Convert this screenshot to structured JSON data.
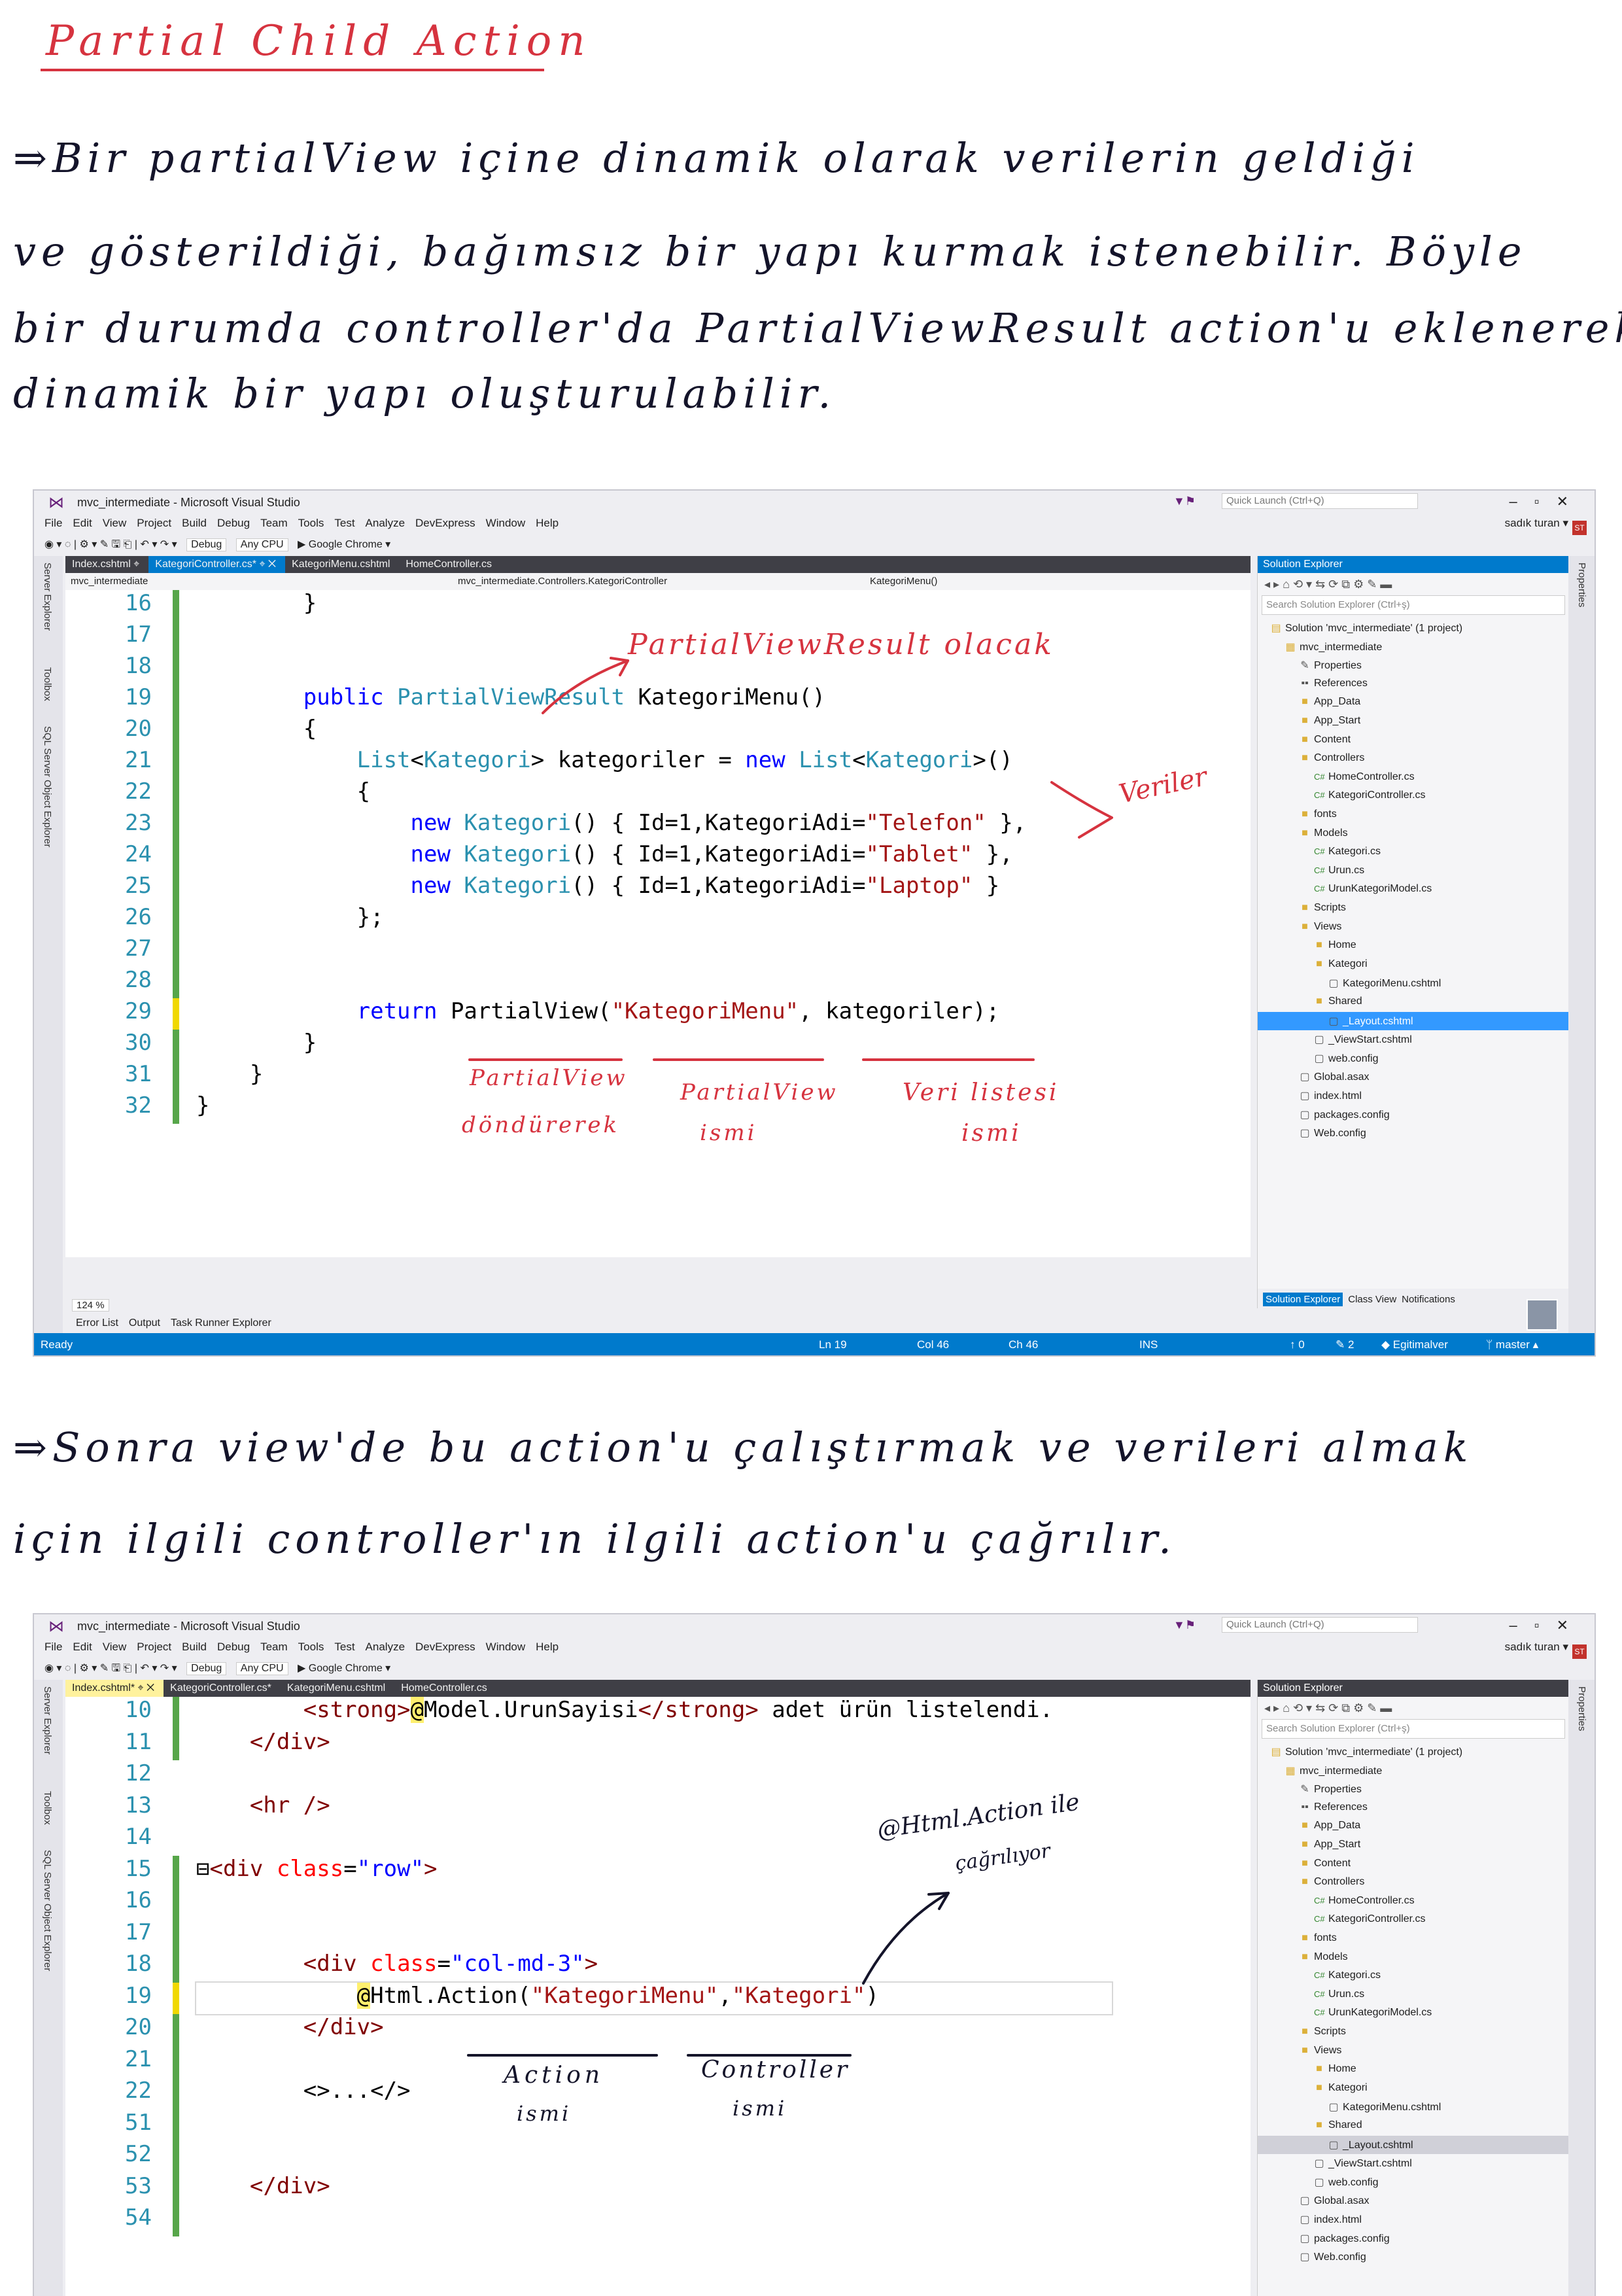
{
  "heading": "Partial Child Action",
  "paragraph1": [
    "⇒Bir partialView içine dinamik olarak verilerin geldiği",
    "ve gösterildiği, bağımsız bir yapı kurmak istenebilir. Böyle",
    "bir durumda controller'da PartialViewResult action'u eklenerek",
    "dinamik bir yapı oluşturulabilir."
  ],
  "paragraph2": [
    "⇒Sonra view'de bu action'u çalıştırmak ve verileri almak",
    "için ilgili controller'ın ilgili action'u çağrılır."
  ],
  "vs": {
    "window_title": "mvc_intermediate - Microsoft Visual Studio",
    "quick_launch": "Quick Launch (Ctrl+Q)",
    "menu": [
      "File",
      "Edit",
      "View",
      "Project",
      "Build",
      "Debug",
      "Team",
      "Tools",
      "Test",
      "Analyze",
      "DevExpress",
      "Window",
      "Help"
    ],
    "user": "sadık turan ▾",
    "user_initials": "ST",
    "toolbar": {
      "config": "Debug",
      "platform": "Any CPU",
      "run": "▶ Google Chrome ▾"
    },
    "side_panels": [
      "Server Explorer",
      "Toolbox",
      "SQL Server Object Explorer"
    ],
    "properties_label": "Properties",
    "solution_explorer": {
      "title": "Solution Explorer",
      "search": "Search Solution Explorer (Ctrl+ş)",
      "bottom_tabs": [
        "Solution Explorer",
        "Class View",
        "Notifications"
      ],
      "items": [
        {
          "label": "Solution 'mvc_intermediate' (1 project)",
          "indent": 0,
          "icon": "solution"
        },
        {
          "label": "mvc_intermediate",
          "indent": 1,
          "icon": "project"
        },
        {
          "label": "Properties",
          "indent": 2,
          "icon": "wrench"
        },
        {
          "label": "References",
          "indent": 2,
          "icon": "ref"
        },
        {
          "label": "App_Data",
          "indent": 2,
          "icon": "folder"
        },
        {
          "label": "App_Start",
          "indent": 2,
          "icon": "folder"
        },
        {
          "label": "Content",
          "indent": 2,
          "icon": "folder"
        },
        {
          "label": "Controllers",
          "indent": 2,
          "icon": "folder"
        },
        {
          "label": "HomeController.cs",
          "indent": 3,
          "icon": "cs"
        },
        {
          "label": "KategoriController.cs",
          "indent": 3,
          "icon": "cs"
        },
        {
          "label": "fonts",
          "indent": 2,
          "icon": "folder"
        },
        {
          "label": "Models",
          "indent": 2,
          "icon": "folder"
        },
        {
          "label": "Kategori.cs",
          "indent": 3,
          "icon": "cs"
        },
        {
          "label": "Urun.cs",
          "indent": 3,
          "icon": "cs"
        },
        {
          "label": "UrunKategoriModel.cs",
          "indent": 3,
          "icon": "cs"
        },
        {
          "label": "Scripts",
          "indent": 2,
          "icon": "folder"
        },
        {
          "label": "Views",
          "indent": 2,
          "icon": "folder"
        },
        {
          "label": "Home",
          "indent": 3,
          "icon": "folder"
        },
        {
          "label": "Kategori",
          "indent": 3,
          "icon": "folder"
        },
        {
          "label": "KategoriMenu.cshtml",
          "indent": 4,
          "icon": "file"
        },
        {
          "label": "Shared",
          "indent": 3,
          "icon": "folder"
        },
        {
          "label": "_Layout.cshtml",
          "indent": 4,
          "icon": "file"
        },
        {
          "label": "_ViewStart.cshtml",
          "indent": 3,
          "icon": "file"
        },
        {
          "label": "web.config",
          "indent": 3,
          "icon": "file"
        },
        {
          "label": "Global.asax",
          "indent": 2,
          "icon": "file"
        },
        {
          "label": "index.html",
          "indent": 2,
          "icon": "file"
        },
        {
          "label": "packages.config",
          "indent": 2,
          "icon": "file"
        },
        {
          "label": "Web.config",
          "indent": 2,
          "icon": "file"
        }
      ]
    },
    "shot1": {
      "tabs": [
        "Index.cshtml ⌖",
        "KategoriController.cs* ⌖ ✕",
        "KategoriMenu.cshtml",
        "HomeController.cs"
      ],
      "nav": [
        "mvc_intermediate",
        "mvc_intermediate.Controllers.KategoriController",
        "KategoriMenu()"
      ],
      "zoom": "124 %",
      "bottom_tabs": [
        "Error List",
        "Output",
        "Task Runner Explorer"
      ],
      "status": {
        "ready": "Ready",
        "ln": "Ln 19",
        "col": "Col 46",
        "ch": "Ch 46",
        "ins": "INS",
        "up": "↑ 0",
        "pen": "✎ 2",
        "repo": "◆ Egitimalver",
        "branch": "ᛘ master ▴"
      },
      "code": [
        [
          "16",
          [
            [
              "        }",
              ""
            ]
          ]
        ],
        [
          "17",
          []
        ],
        [
          "18",
          []
        ],
        [
          "19",
          [
            [
              "        ",
              ""
            ],
            [
              "public",
              "kw"
            ],
            [
              " ",
              ""
            ],
            [
              "PartialViewResult",
              "ty"
            ],
            [
              " KategoriMenu()",
              ""
            ]
          ]
        ],
        [
          "20",
          [
            [
              "        {",
              ""
            ]
          ]
        ],
        [
          "21",
          [
            [
              "            ",
              ""
            ],
            [
              "List",
              "ty"
            ],
            [
              "<",
              ""
            ],
            [
              "Kategori",
              "ty"
            ],
            [
              "> kategoriler = ",
              ""
            ],
            [
              "new",
              "kw"
            ],
            [
              " ",
              ""
            ],
            [
              "List",
              "ty"
            ],
            [
              "<",
              ""
            ],
            [
              "Kategori",
              "ty"
            ],
            [
              ">()",
              ""
            ]
          ]
        ],
        [
          "22",
          [
            [
              "            {",
              ""
            ]
          ]
        ],
        [
          "23",
          [
            [
              "                ",
              ""
            ],
            [
              "new",
              "kw"
            ],
            [
              " ",
              ""
            ],
            [
              "Kategori",
              "ty"
            ],
            [
              "() { Id=1,KategoriAdi=",
              ""
            ],
            [
              "\"Telefon\"",
              "st"
            ],
            [
              " },",
              ""
            ]
          ]
        ],
        [
          "24",
          [
            [
              "                ",
              ""
            ],
            [
              "new",
              "kw"
            ],
            [
              " ",
              ""
            ],
            [
              "Kategori",
              "ty"
            ],
            [
              "() { Id=1,KategoriAdi=",
              ""
            ],
            [
              "\"Tablet\"",
              "st"
            ],
            [
              " },",
              ""
            ]
          ]
        ],
        [
          "25",
          [
            [
              "                ",
              ""
            ],
            [
              "new",
              "kw"
            ],
            [
              " ",
              ""
            ],
            [
              "Kategori",
              "ty"
            ],
            [
              "() { Id=1,KategoriAdi=",
              ""
            ],
            [
              "\"Laptop\"",
              "st"
            ],
            [
              " }",
              ""
            ]
          ]
        ],
        [
          "26",
          [
            [
              "            };",
              ""
            ]
          ]
        ],
        [
          "27",
          []
        ],
        [
          "28",
          []
        ],
        [
          "29",
          [
            [
              "            ",
              ""
            ],
            [
              "return",
              "kw"
            ],
            [
              " PartialView(",
              ""
            ],
            [
              "\"KategoriMenu\"",
              "st"
            ],
            [
              ", kategoriler);",
              ""
            ]
          ]
        ],
        [
          "30",
          [
            [
              "        }",
              ""
            ]
          ]
        ],
        [
          "31",
          [
            [
              "    }",
              ""
            ]
          ]
        ],
        [
          "32",
          [
            [
              "}",
              ""
            ]
          ]
        ]
      ]
    },
    "shot2": {
      "tabs": [
        "Index.cshtml* ⌖ ✕",
        "KategoriController.cs*",
        "KategoriMenu.cshtml",
        "HomeController.cs"
      ],
      "code": [
        [
          "10",
          [
            [
              "        ",
              ""
            ],
            [
              "<strong>",
              "tag"
            ],
            [
              "@",
              "hl"
            ],
            [
              "Model.UrunSayisi",
              ""
            ],
            [
              "</strong>",
              "tag"
            ],
            [
              " adet ürün listelendi.",
              ""
            ]
          ]
        ],
        [
          "11",
          [
            [
              "    ",
              ""
            ],
            [
              "</div>",
              "tag"
            ]
          ]
        ],
        [
          "12",
          []
        ],
        [
          "13",
          [
            [
              "    ",
              ""
            ],
            [
              "<hr />",
              "tag"
            ]
          ]
        ],
        [
          "14",
          []
        ],
        [
          "15",
          [
            [
              "⊟",
              ""
            ],
            [
              "<div ",
              "tag"
            ],
            [
              "class",
              "at"
            ],
            [
              "=",
              ""
            ],
            [
              "\"row\"",
              "kw"
            ],
            [
              ">",
              "tag"
            ]
          ]
        ],
        [
          "16",
          []
        ],
        [
          "17",
          []
        ],
        [
          "18",
          [
            [
              "        ",
              ""
            ],
            [
              "<div ",
              "tag"
            ],
            [
              "class",
              "at"
            ],
            [
              "=",
              ""
            ],
            [
              "\"col-md-3\"",
              "kw"
            ],
            [
              ">",
              "tag"
            ]
          ]
        ],
        [
          "19",
          [
            [
              "            ",
              ""
            ],
            [
              "@",
              "hl"
            ],
            [
              "Html.Action(",
              ""
            ],
            [
              "\"KategoriMenu\"",
              "st"
            ],
            [
              ",",
              ""
            ],
            [
              "\"Kategori\"",
              "st"
            ],
            [
              ")",
              ""
            ]
          ]
        ],
        [
          "20",
          [
            [
              "        ",
              ""
            ],
            [
              "</div>",
              "tag"
            ]
          ]
        ],
        [
          "21",
          []
        ],
        [
          "22",
          [
            [
              "        <>...</>",
              ""
            ]
          ]
        ],
        [
          "51",
          []
        ],
        [
          "52",
          []
        ],
        [
          "53",
          [
            [
              "    ",
              ""
            ],
            [
              "</div>",
              "tag"
            ]
          ]
        ],
        [
          "54",
          []
        ]
      ]
    }
  },
  "annotations": {
    "s1_partial_result": "PartialViewResult olacak",
    "s1_veriler": "Veriler",
    "s1_pv_donduruerek": [
      "PartialView",
      "döndürerek"
    ],
    "s1_pv_ismi": [
      "PartialView",
      "ismi"
    ],
    "s1_veri_listesi": [
      "Veri listesi",
      "ismi"
    ],
    "s2_html_action": [
      "@Html.Action ile",
      "çağrılıyor"
    ],
    "s2_action_ismi": [
      "Action",
      "ismi"
    ],
    "s2_controller_ismi": [
      "Controller",
      "ismi"
    ]
  }
}
